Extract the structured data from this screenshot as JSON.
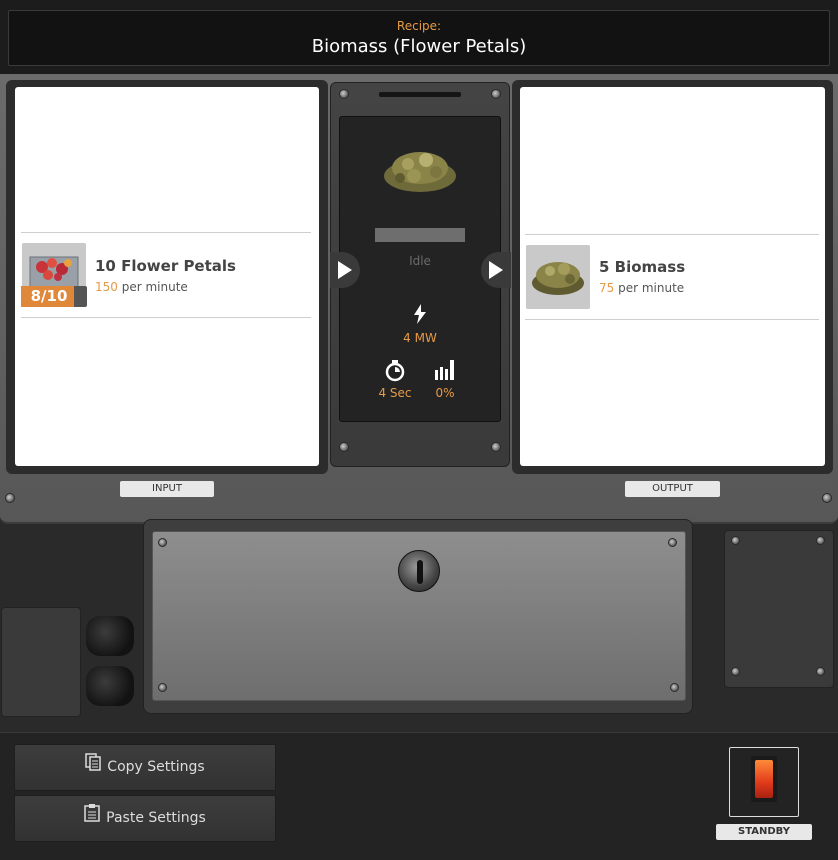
{
  "header": {
    "recipe_label": "Recipe:",
    "recipe_name": "Biomass (Flower Petals)"
  },
  "input": {
    "section_label": "INPUT",
    "item_name": "10 Flower Petals",
    "rate_value": "150",
    "rate_unit": "per minute",
    "count_text": "8/10",
    "count_fraction": 0.8
  },
  "output": {
    "section_label": "OUTPUT",
    "item_name": "5 Biomass",
    "rate_value": "75",
    "rate_unit": "per minute"
  },
  "machine": {
    "status": "Idle",
    "progress_fraction": 0,
    "power": "4 MW",
    "cycle_time": "4 Sec",
    "productivity": "0%"
  },
  "controls": {
    "copy_label": "Copy Settings",
    "paste_label": "Paste Settings",
    "standby_label": "STANDBY"
  },
  "colors": {
    "accent": "#e59a47",
    "switch": "#e03a1a"
  },
  "icons": {
    "power": "lightning-icon",
    "time": "stopwatch-icon",
    "productivity": "bar-chart-icon",
    "copy": "copy-icon",
    "paste": "clipboard-icon",
    "lock": "keyhole-icon"
  }
}
